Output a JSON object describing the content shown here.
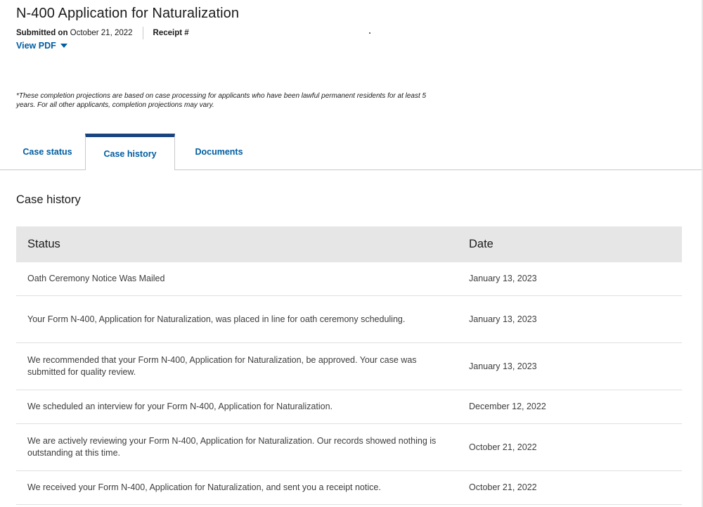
{
  "header": {
    "title": "N-400 Application for Naturalization",
    "submitted_label": "Submitted on",
    "submitted_date": "October 21, 2022",
    "receipt_label": "Receipt #",
    "view_pdf_label": "View PDF"
  },
  "disclaimer": "*These completion projections are based on case processing for applicants who have been lawful permanent residents for at least 5 years. For all other applicants, completion projections may vary.",
  "tabs": [
    {
      "label": "Case status",
      "active": false
    },
    {
      "label": "Case history",
      "active": true
    },
    {
      "label": "Documents",
      "active": false
    }
  ],
  "section_title": "Case history",
  "table": {
    "columns": [
      "Status",
      "Date"
    ],
    "rows": [
      {
        "status": "Oath Ceremony Notice Was Mailed",
        "date": "January 13, 2023"
      },
      {
        "status": "Your Form N-400, Application for Naturalization, was placed in line for oath ceremony scheduling.",
        "date": "January 13, 2023"
      },
      {
        "status": "We recommended that your Form N-400, Application for Naturalization, be approved. Your case was submitted for quality review.",
        "date": "January 13, 2023"
      },
      {
        "status": "We scheduled an interview for your Form N-400, Application for Naturalization.",
        "date": "December 12, 2022"
      },
      {
        "status": "We are actively reviewing your Form N-400, Application for Naturalization. Our records showed nothing is outstanding at this time.",
        "date": "October 21, 2022"
      },
      {
        "status": "We received your Form N-400, Application for Naturalization, and sent you a receipt notice.",
        "date": "October 21, 2022"
      }
    ]
  },
  "colors": {
    "link": "#005ea2",
    "active_tab_border": "#1a4480",
    "table_header_bg": "#e6e6e6"
  },
  "icons": {
    "view_pdf": "caret-down-icon"
  }
}
